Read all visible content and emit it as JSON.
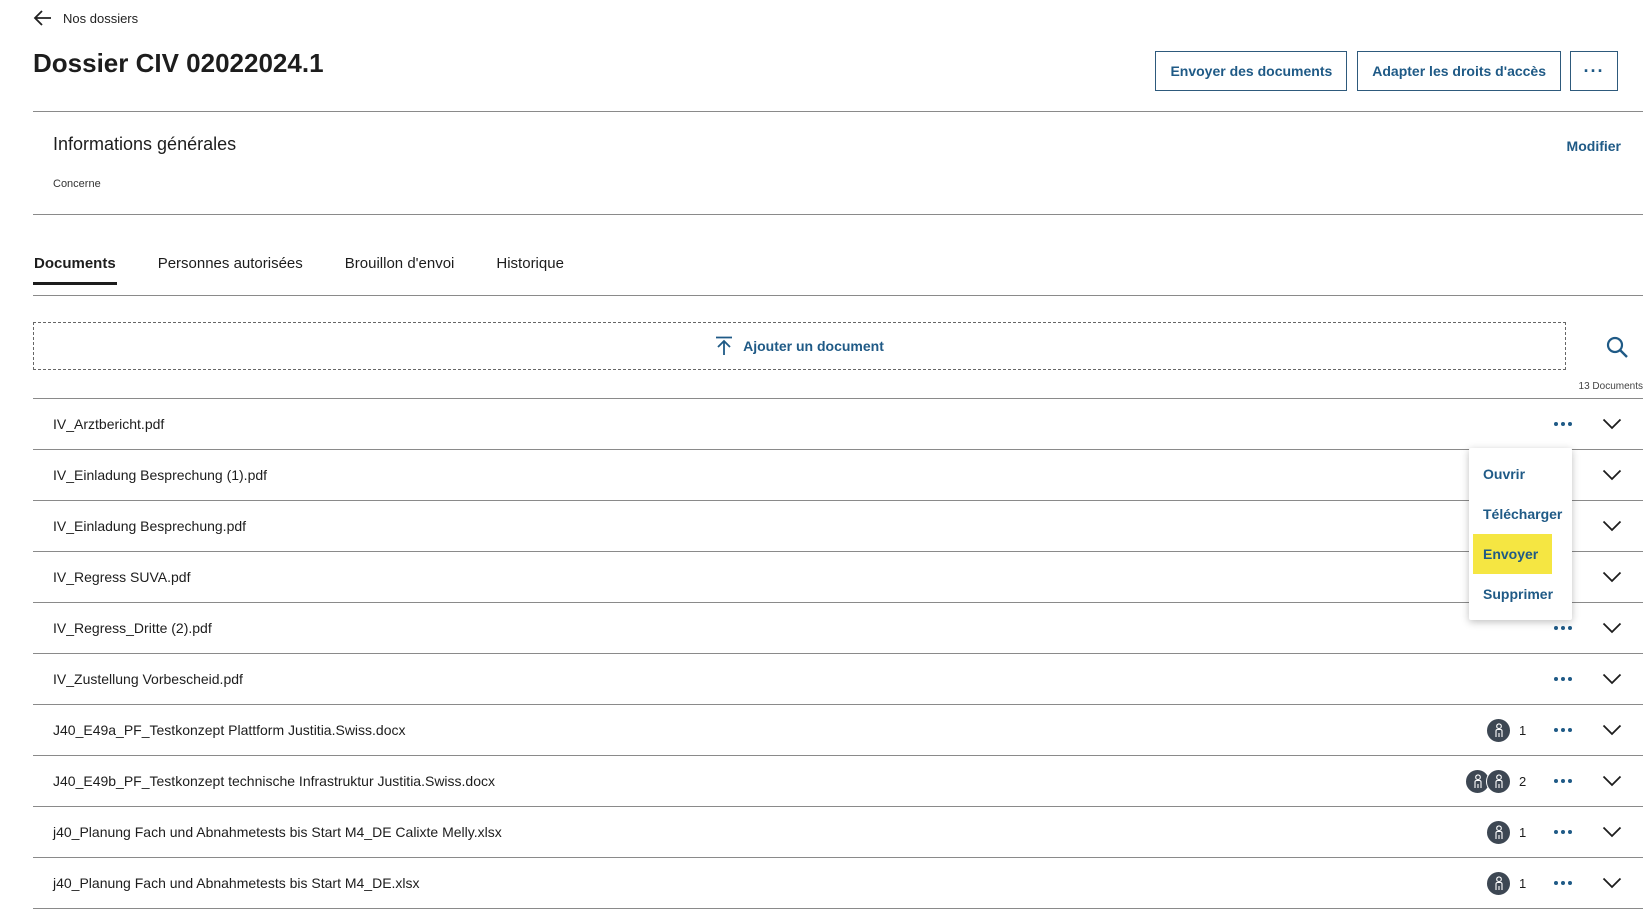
{
  "nav": {
    "back_label": "Nos dossiers"
  },
  "header": {
    "title": "Dossier CIV 02022024.1",
    "send_docs": "Envoyer des documents",
    "adapt_rights": "Adapter les droits d'accès",
    "more": "···"
  },
  "info": {
    "title": "Informations générales",
    "subtitle": "Concerne",
    "modify": "Modifier"
  },
  "tabs": [
    {
      "label": "Documents",
      "active": true
    },
    {
      "label": "Personnes autorisées",
      "active": false
    },
    {
      "label": "Brouillon d'envoi",
      "active": false
    },
    {
      "label": "Historique",
      "active": false
    }
  ],
  "upload": {
    "label": "Ajouter un document"
  },
  "doc_count": "13 Documents",
  "documents": [
    {
      "name": "IV_Arztbericht.pdf",
      "avatars": 0,
      "count": ""
    },
    {
      "name": "IV_Einladung Besprechung (1).pdf",
      "avatars": 0,
      "count": ""
    },
    {
      "name": "IV_Einladung Besprechung.pdf",
      "avatars": 0,
      "count": ""
    },
    {
      "name": "IV_Regress SUVA.pdf",
      "avatars": 0,
      "count": ""
    },
    {
      "name": "IV_Regress_Dritte (2).pdf",
      "avatars": 0,
      "count": ""
    },
    {
      "name": "IV_Zustellung Vorbescheid.pdf",
      "avatars": 0,
      "count": ""
    },
    {
      "name": "J40_E49a_PF_Testkonzept Plattform Justitia.Swiss.docx",
      "avatars": 1,
      "count": "1"
    },
    {
      "name": "J40_E49b_PF_Testkonzept technische Infrastruktur Justitia.Swiss.docx",
      "avatars": 2,
      "count": "2"
    },
    {
      "name": "j40_Planung Fach und Abnahmetests bis Start M4_DE Calixte Melly.xlsx",
      "avatars": 1,
      "count": "1"
    },
    {
      "name": "j40_Planung Fach und Abnahmetests bis Start M4_DE.xlsx",
      "avatars": 1,
      "count": "1"
    }
  ],
  "context_menu": {
    "items": [
      {
        "label": "Ouvrir",
        "highlighted": false
      },
      {
        "label": "Télécharger",
        "highlighted": false
      },
      {
        "label": "Envoyer",
        "highlighted": true
      },
      {
        "label": "Supprimer",
        "highlighted": false
      }
    ]
  },
  "colors": {
    "accent": "#1f5a86",
    "highlight": "#f5e642",
    "avatar_bg": "#3d4753"
  },
  "icons": {
    "back": "arrow-left-icon",
    "upload": "upload-icon",
    "search": "search-icon",
    "more": "more-dots-icon",
    "expand": "chevron-down-icon",
    "person": "person-icon"
  }
}
